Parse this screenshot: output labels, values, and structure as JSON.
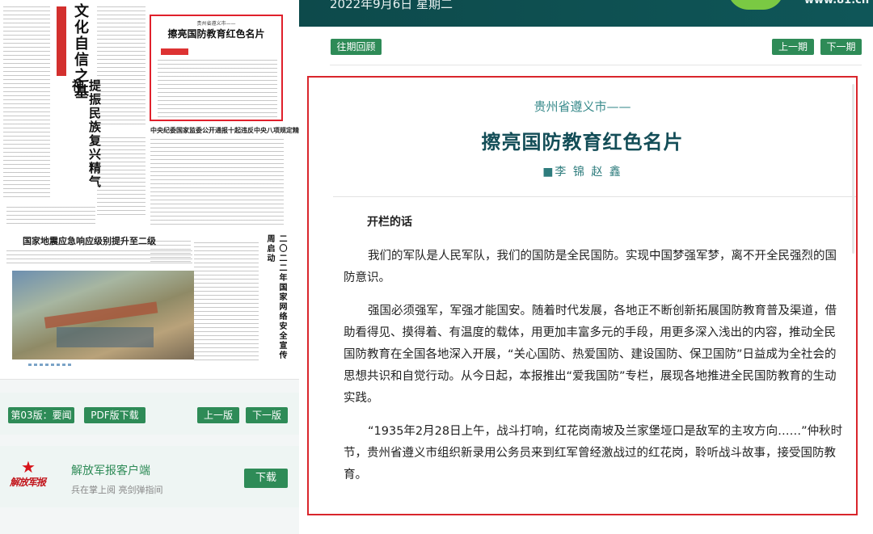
{
  "header": {
    "date": "2022年9月6日 星期二",
    "url": "www.81.cn"
  },
  "toolbar": {
    "past_review": "往期回顾",
    "prev_issue": "上一期",
    "next_issue": "下一期"
  },
  "newspaper_thumb": {
    "highlight_kicker": "贵州省遵义市——",
    "highlight_title": "擦亮国防教育红色名片",
    "headline_vertical": "文化自信之基",
    "headline_vertical2": "提振民族复兴精气神",
    "subhead_right": "中央纪委国家监委公开通报十起违反中央八项规定精神典型问题",
    "subhead_left": "国家地震应急响应级别提升至二级",
    "subhead_right2": "二〇二二年国家网络安全宣传周启动"
  },
  "edition": {
    "label": "第03版：要闻",
    "pdf_button": "PDF版下载",
    "prev_edition": "上一版",
    "next_edition": "下一版"
  },
  "client": {
    "logo_text": "解放军报",
    "title": "解放军报客户端",
    "subtitle": "兵在掌上阅 亮剑弹指间",
    "download": "下载"
  },
  "article": {
    "kicker": "贵州省遵义市——",
    "title": "擦亮国防教育红色名片",
    "author": "■李 锦 赵 鑫",
    "subheading": "开栏的话",
    "paragraphs": [
      "我们的军队是人民军队，我们的国防是全民国防。实现中国梦强军梦，离不开全民强烈的国防意识。",
      "强国必须强军，军强才能国安。随着时代发展，各地正不断创新拓展国防教育普及渠道，借助看得见、摸得着、有温度的载体，用更加丰富多元的手段，用更多深入浅出的内容，推动全民国防教育在全国各地深入开展，“关心国防、热爱国防、建设国防、保卫国防”日益成为全社会的思想共识和自觉行动。从今日起，本报推出“爱我国防”专栏，展现各地推进全民国防教育的生动实践。",
      "“1935年2月28日上午，战斗打响，红花岗南坡及兰家堡垭口是敌军的主攻方向……”仲秋时节，贵州省遵义市组织新录用公务员来到红军曾经激战过的红花岗，聆听战斗故事，接受国防教育。"
    ]
  },
  "colors": {
    "accent_green": "#2e8b57",
    "title_teal": "#134d57",
    "highlight_red": "#d9262c",
    "header_bg": "#0f5658"
  }
}
